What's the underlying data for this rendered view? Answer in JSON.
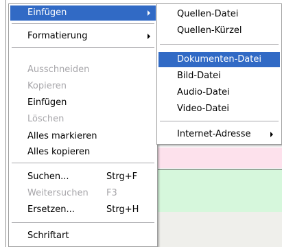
{
  "background": {
    "fragment_text": "|"
  },
  "context_menu": {
    "items": [
      {
        "label": "Einfügen",
        "has_submenu": true,
        "selected": true
      },
      {
        "label": "Formatierung",
        "has_submenu": true
      },
      {
        "label": "Ausschneiden",
        "disabled": true
      },
      {
        "label": "Kopieren",
        "disabled": true
      },
      {
        "label": "Einfügen"
      },
      {
        "label": "Löschen",
        "disabled": true
      },
      {
        "label": "Alles markieren"
      },
      {
        "label": "Alles kopieren"
      },
      {
        "label": "Suchen...",
        "shortcut": "Strg+F"
      },
      {
        "label": "Weitersuchen",
        "shortcut": "F3",
        "disabled": true
      },
      {
        "label": "Ersetzen...",
        "shortcut": "Strg+H"
      },
      {
        "label": "Schriftart"
      }
    ]
  },
  "submenu": {
    "items": [
      {
        "label": "Quellen-Datei"
      },
      {
        "label": "Quellen-Kürzel"
      },
      {
        "label": "Dokumenten-Datei",
        "selected": true
      },
      {
        "label": "Bild-Datei"
      },
      {
        "label": "Audio-Datei"
      },
      {
        "label": "Video-Datei"
      },
      {
        "label": "Internet-Adresse",
        "has_submenu": true
      }
    ]
  },
  "colors": {
    "selection": "#316ac5",
    "disabled_text": "#a7a6aa",
    "bg_pink": "#fde1ec",
    "bg_green": "#d6f7dc"
  }
}
